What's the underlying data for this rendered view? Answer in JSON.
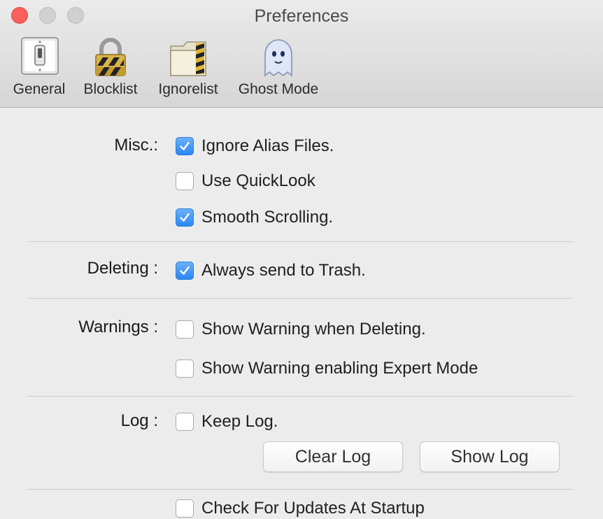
{
  "window": {
    "title": "Preferences",
    "close_color": "#fc605c"
  },
  "toolbar": {
    "items": [
      {
        "label": "General",
        "icon": "light-switch-icon"
      },
      {
        "label": "Blocklist",
        "icon": "padlock-icon"
      },
      {
        "label": "Ignorelist",
        "icon": "striped-folder-icon"
      },
      {
        "label": "Ghost Mode",
        "icon": "ghost-icon"
      }
    ]
  },
  "sections": {
    "misc": {
      "label": "Misc.:",
      "options": [
        {
          "label": "Ignore Alias Files.",
          "checked": true
        },
        {
          "label": "Use QuickLook",
          "checked": false
        },
        {
          "label": "Smooth Scrolling.",
          "checked": true
        }
      ]
    },
    "deleting": {
      "label": "Deleting :",
      "options": [
        {
          "label": "Always send to Trash.",
          "checked": true
        }
      ]
    },
    "warnings": {
      "label": "Warnings :",
      "options": [
        {
          "label": "Show Warning when Deleting.",
          "checked": false
        },
        {
          "label": "Show Warning enabling Expert Mode",
          "checked": false
        }
      ]
    },
    "log": {
      "label": "Log :",
      "options": [
        {
          "label": "Keep Log.",
          "checked": false
        }
      ],
      "clear_button": "Clear Log",
      "show_button": "Show Log"
    },
    "updates": {
      "options": [
        {
          "label": "Check For Updates At Startup",
          "checked": false
        }
      ]
    }
  },
  "colors": {
    "checkbox_accent": "#2c86f5",
    "background": "#ececec"
  }
}
